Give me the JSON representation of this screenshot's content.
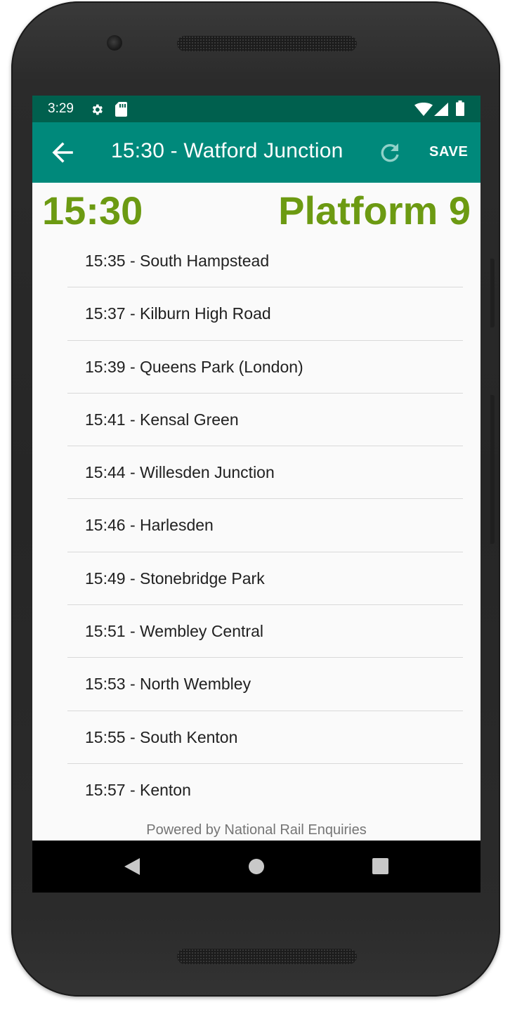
{
  "status_bar": {
    "time": "3:29",
    "icons": [
      "gear-icon",
      "sd-card-icon",
      "wifi-icon",
      "cell-signal-icon",
      "battery-icon"
    ]
  },
  "app_bar": {
    "title": "15:30 - Watford Junction",
    "back_icon": "arrow-back-icon",
    "refresh_icon": "refresh-icon",
    "save_label": "SAVE"
  },
  "header": {
    "departure_time": "15:30",
    "platform": "Platform 9"
  },
  "stops": [
    "15:35 - South Hampstead",
    "15:37 - Kilburn High Road",
    "15:39 - Queens Park (London)",
    "15:41 - Kensal Green",
    "15:44 - Willesden Junction",
    "15:46 - Harlesden",
    "15:49 - Stonebridge Park",
    "15:51 - Wembley Central",
    "15:53 - North Wembley",
    "15:55 - South Kenton",
    "15:57 - Kenton"
  ],
  "footer": {
    "credit": "Powered by National Rail Enquiries"
  },
  "nav_bar": {
    "icons": [
      "back-triangle-icon",
      "home-circle-icon",
      "recents-square-icon"
    ]
  },
  "colors": {
    "status_bar": "#00604e",
    "app_bar": "#00897b",
    "accent_green": "#6c9a12",
    "refresh_icon": "#8fd1c8",
    "divider": "#d9d9d9",
    "credit_text": "#757575"
  }
}
